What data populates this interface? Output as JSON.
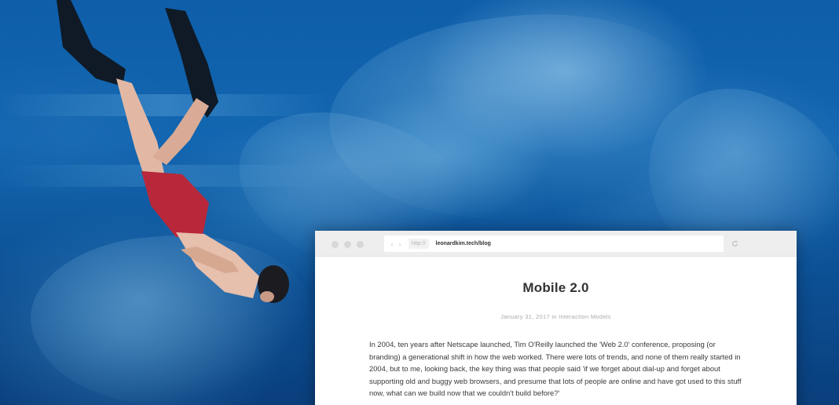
{
  "browser": {
    "protocol": "http://",
    "address": "leonardkim.tech/blog",
    "back_icon": "chevron-left-icon",
    "forward_icon": "chevron-right-icon",
    "reload_icon": "reload-icon"
  },
  "post": {
    "title": "Mobile 2.0",
    "date": "January 31, 2017",
    "meta_in": "in",
    "category": "Interaction Models",
    "paragraph": "In 2004, ten years after Netscape launched, Tim O'Reilly launched the 'Web 2.0' conference, proposing (or branding) a generational shift in how the web worked. There were lots of trends, and none of them really started in 2004, but to me, looking back, the key thing was that people said 'if we forget about dial-up and forget about supporting old and buggy web browsers, and presume that lots of people are online and have got used to this stuff now, what can we build now that we couldn't build before?'"
  },
  "colors": {
    "water": "#0e5ea9",
    "swim_shorts": "#b8283a",
    "fins": "#101820",
    "chrome_bg": "#eeeeee"
  }
}
